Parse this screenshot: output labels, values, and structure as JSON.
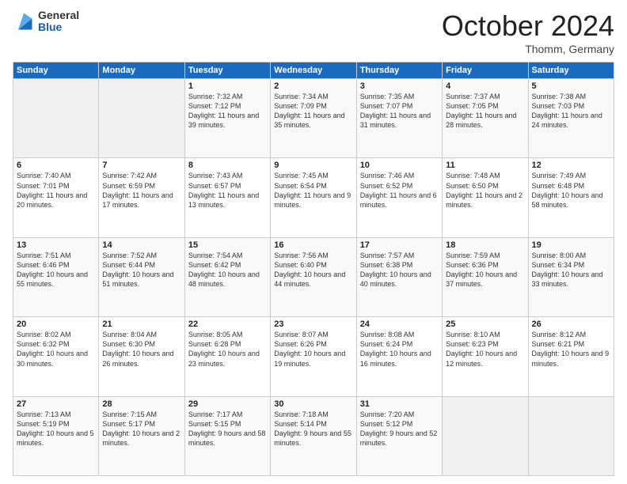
{
  "logo": {
    "general": "General",
    "blue": "Blue"
  },
  "header": {
    "month": "October 2024",
    "location": "Thomm, Germany"
  },
  "days_of_week": [
    "Sunday",
    "Monday",
    "Tuesday",
    "Wednesday",
    "Thursday",
    "Friday",
    "Saturday"
  ],
  "weeks": [
    [
      {
        "day": "",
        "empty": true
      },
      {
        "day": "",
        "empty": true
      },
      {
        "day": "1",
        "sunrise": "Sunrise: 7:32 AM",
        "sunset": "Sunset: 7:12 PM",
        "daylight": "Daylight: 11 hours and 39 minutes."
      },
      {
        "day": "2",
        "sunrise": "Sunrise: 7:34 AM",
        "sunset": "Sunset: 7:09 PM",
        "daylight": "Daylight: 11 hours and 35 minutes."
      },
      {
        "day": "3",
        "sunrise": "Sunrise: 7:35 AM",
        "sunset": "Sunset: 7:07 PM",
        "daylight": "Daylight: 11 hours and 31 minutes."
      },
      {
        "day": "4",
        "sunrise": "Sunrise: 7:37 AM",
        "sunset": "Sunset: 7:05 PM",
        "daylight": "Daylight: 11 hours and 28 minutes."
      },
      {
        "day": "5",
        "sunrise": "Sunrise: 7:38 AM",
        "sunset": "Sunset: 7:03 PM",
        "daylight": "Daylight: 11 hours and 24 minutes."
      }
    ],
    [
      {
        "day": "6",
        "sunrise": "Sunrise: 7:40 AM",
        "sunset": "Sunset: 7:01 PM",
        "daylight": "Daylight: 11 hours and 20 minutes."
      },
      {
        "day": "7",
        "sunrise": "Sunrise: 7:42 AM",
        "sunset": "Sunset: 6:59 PM",
        "daylight": "Daylight: 11 hours and 17 minutes."
      },
      {
        "day": "8",
        "sunrise": "Sunrise: 7:43 AM",
        "sunset": "Sunset: 6:57 PM",
        "daylight": "Daylight: 11 hours and 13 minutes."
      },
      {
        "day": "9",
        "sunrise": "Sunrise: 7:45 AM",
        "sunset": "Sunset: 6:54 PM",
        "daylight": "Daylight: 11 hours and 9 minutes."
      },
      {
        "day": "10",
        "sunrise": "Sunrise: 7:46 AM",
        "sunset": "Sunset: 6:52 PM",
        "daylight": "Daylight: 11 hours and 6 minutes."
      },
      {
        "day": "11",
        "sunrise": "Sunrise: 7:48 AM",
        "sunset": "Sunset: 6:50 PM",
        "daylight": "Daylight: 11 hours and 2 minutes."
      },
      {
        "day": "12",
        "sunrise": "Sunrise: 7:49 AM",
        "sunset": "Sunset: 6:48 PM",
        "daylight": "Daylight: 10 hours and 58 minutes."
      }
    ],
    [
      {
        "day": "13",
        "sunrise": "Sunrise: 7:51 AM",
        "sunset": "Sunset: 6:46 PM",
        "daylight": "Daylight: 10 hours and 55 minutes."
      },
      {
        "day": "14",
        "sunrise": "Sunrise: 7:52 AM",
        "sunset": "Sunset: 6:44 PM",
        "daylight": "Daylight: 10 hours and 51 minutes."
      },
      {
        "day": "15",
        "sunrise": "Sunrise: 7:54 AM",
        "sunset": "Sunset: 6:42 PM",
        "daylight": "Daylight: 10 hours and 48 minutes."
      },
      {
        "day": "16",
        "sunrise": "Sunrise: 7:56 AM",
        "sunset": "Sunset: 6:40 PM",
        "daylight": "Daylight: 10 hours and 44 minutes."
      },
      {
        "day": "17",
        "sunrise": "Sunrise: 7:57 AM",
        "sunset": "Sunset: 6:38 PM",
        "daylight": "Daylight: 10 hours and 40 minutes."
      },
      {
        "day": "18",
        "sunrise": "Sunrise: 7:59 AM",
        "sunset": "Sunset: 6:36 PM",
        "daylight": "Daylight: 10 hours and 37 minutes."
      },
      {
        "day": "19",
        "sunrise": "Sunrise: 8:00 AM",
        "sunset": "Sunset: 6:34 PM",
        "daylight": "Daylight: 10 hours and 33 minutes."
      }
    ],
    [
      {
        "day": "20",
        "sunrise": "Sunrise: 8:02 AM",
        "sunset": "Sunset: 6:32 PM",
        "daylight": "Daylight: 10 hours and 30 minutes."
      },
      {
        "day": "21",
        "sunrise": "Sunrise: 8:04 AM",
        "sunset": "Sunset: 6:30 PM",
        "daylight": "Daylight: 10 hours and 26 minutes."
      },
      {
        "day": "22",
        "sunrise": "Sunrise: 8:05 AM",
        "sunset": "Sunset: 6:28 PM",
        "daylight": "Daylight: 10 hours and 23 minutes."
      },
      {
        "day": "23",
        "sunrise": "Sunrise: 8:07 AM",
        "sunset": "Sunset: 6:26 PM",
        "daylight": "Daylight: 10 hours and 19 minutes."
      },
      {
        "day": "24",
        "sunrise": "Sunrise: 8:08 AM",
        "sunset": "Sunset: 6:24 PM",
        "daylight": "Daylight: 10 hours and 16 minutes."
      },
      {
        "day": "25",
        "sunrise": "Sunrise: 8:10 AM",
        "sunset": "Sunset: 6:23 PM",
        "daylight": "Daylight: 10 hours and 12 minutes."
      },
      {
        "day": "26",
        "sunrise": "Sunrise: 8:12 AM",
        "sunset": "Sunset: 6:21 PM",
        "daylight": "Daylight: 10 hours and 9 minutes."
      }
    ],
    [
      {
        "day": "27",
        "sunrise": "Sunrise: 7:13 AM",
        "sunset": "Sunset: 5:19 PM",
        "daylight": "Daylight: 10 hours and 5 minutes."
      },
      {
        "day": "28",
        "sunrise": "Sunrise: 7:15 AM",
        "sunset": "Sunset: 5:17 PM",
        "daylight": "Daylight: 10 hours and 2 minutes."
      },
      {
        "day": "29",
        "sunrise": "Sunrise: 7:17 AM",
        "sunset": "Sunset: 5:15 PM",
        "daylight": "Daylight: 9 hours and 58 minutes."
      },
      {
        "day": "30",
        "sunrise": "Sunrise: 7:18 AM",
        "sunset": "Sunset: 5:14 PM",
        "daylight": "Daylight: 9 hours and 55 minutes."
      },
      {
        "day": "31",
        "sunrise": "Sunrise: 7:20 AM",
        "sunset": "Sunset: 5:12 PM",
        "daylight": "Daylight: 9 hours and 52 minutes."
      },
      {
        "day": "",
        "empty": true
      },
      {
        "day": "",
        "empty": true
      }
    ]
  ]
}
